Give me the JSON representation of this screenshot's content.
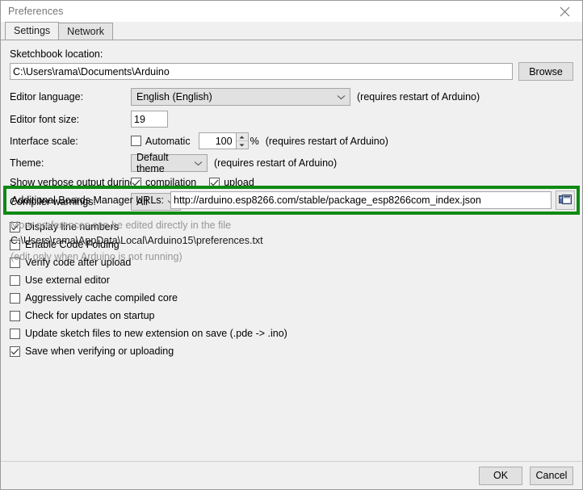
{
  "window": {
    "title": "Preferences",
    "close_icon": "close-icon"
  },
  "tabs": [
    {
      "label": "Settings",
      "active": true
    },
    {
      "label": "Network",
      "active": false
    }
  ],
  "settings": {
    "sketchbook": {
      "label": "Sketchbook location:",
      "value": "C:\\Users\\rama\\Documents\\Arduino",
      "browse_label": "Browse"
    },
    "editor_language": {
      "label": "Editor language:",
      "value": "English (English)",
      "note": "(requires restart of Arduino)"
    },
    "editor_font_size": {
      "label": "Editor font size:",
      "value": "19"
    },
    "interface_scale": {
      "label": "Interface scale:",
      "automatic_label": "Automatic",
      "automatic_checked": false,
      "value": "100",
      "percent": "%",
      "note": "(requires restart of Arduino)"
    },
    "theme": {
      "label": "Theme:",
      "value": "Default theme",
      "note": "(requires restart of Arduino)"
    },
    "verbose": {
      "label": "Show verbose output during:",
      "options": [
        {
          "label": "compilation",
          "checked": true
        },
        {
          "label": "upload",
          "checked": true
        }
      ]
    },
    "compiler_warnings": {
      "label": "Compiler warnings:",
      "value": "All"
    },
    "checkboxes": [
      {
        "label": "Display line numbers",
        "checked": true
      },
      {
        "label": "Enable Code Folding",
        "checked": false
      },
      {
        "label": "Verify code after upload",
        "checked": false
      },
      {
        "label": "Use external editor",
        "checked": false
      },
      {
        "label": "Aggressively cache compiled core",
        "checked": false
      },
      {
        "label": "Check for updates on startup",
        "checked": false
      },
      {
        "label": "Update sketch files to new extension on save (.pde -> .ino)",
        "checked": false
      },
      {
        "label": "Save when verifying or uploading",
        "checked": true
      }
    ],
    "boards_manager": {
      "label": "Additional Boards Manager URLs:",
      "value": "http://arduino.esp8266.com/stable/package_esp8266com_index.json",
      "copy_icon": "copy-windows-icon",
      "highlight_color": "#0e8a12"
    },
    "footnotes": {
      "line1": "More preferences can be edited directly in the file",
      "line2": "C:\\Users\\rama\\AppData\\Local\\Arduino15\\preferences.txt",
      "line3": "(edit only when Arduino is not running)"
    }
  },
  "footer": {
    "ok_label": "OK",
    "cancel_label": "Cancel"
  }
}
